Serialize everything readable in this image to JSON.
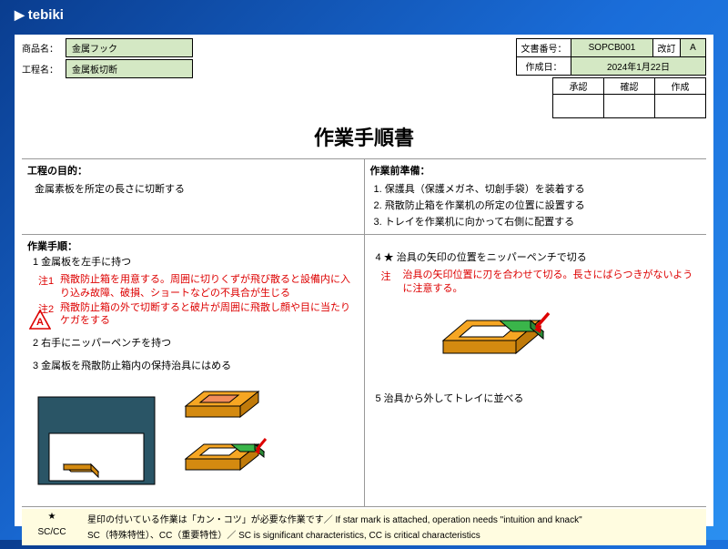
{
  "app": {
    "name": "tebiki"
  },
  "meta": {
    "product_label": "商品名：",
    "product_value": "金属フック",
    "process_label": "工程名：",
    "process_value": "金属板切断",
    "doc_no_label": "文書番号：",
    "doc_no_value": "SOPCB001",
    "rev_label": "改訂",
    "rev_value": "A",
    "date_label": "作成日：",
    "date_value": "2024年1月22日",
    "approval": {
      "c1": "承認",
      "c2": "確認",
      "c3": "作成"
    }
  },
  "title": "作業手順書",
  "purpose": {
    "heading": "工程の目的：",
    "text": "金属素板を所定の長さに切断する"
  },
  "prep": {
    "heading": "作業前準備：",
    "items": {
      "1": "1. 保護具（保護メガネ、切創手袋）を装着する",
      "2": "2. 飛散防止箱を作業机の所定の位置に設置する",
      "3": "3. トレイを作業机に向かって右側に配置する"
    }
  },
  "procedure": {
    "heading": "作業手順：",
    "left": {
      "s1": "1 金属板を左手に持つ",
      "s1n1_label": "注1",
      "s1n1_text": "飛散防止箱を用意する。周囲に切りくずが飛び散ると設備内に入り込み故障、破損、ショートなどの不具合が生じる",
      "s1n2_label": "注2",
      "s1n2_text": "飛散防止箱の外で切断すると破片が周囲に飛散し顔や目に当たりケガをする",
      "s2": "2 右手にニッパーペンチを持つ",
      "s3": "3 金属板を飛散防止箱内の保持治具にはめる"
    },
    "right": {
      "s4": "4 ★ 治具の矢印の位置をニッパーペンチで切る",
      "s4n_label": "注",
      "s4n_text": "治具の矢印位置に刃を合わせて切る。長さにばらつきがないように注意する。",
      "s5": "5 治具から外してトレイに並べる"
    }
  },
  "footer": {
    "r1_sym": "★",
    "r1_text": "星印の付いている作業は「カン・コツ」が必要な作業です／ If star mark is attached, operation needs \"intuition and knack\"",
    "r2_sym": "SC/CC",
    "r2_text": "SC（特殊特性）、CC（重要特性）／ SC is significant characteristics, CC is critical characteristics"
  }
}
